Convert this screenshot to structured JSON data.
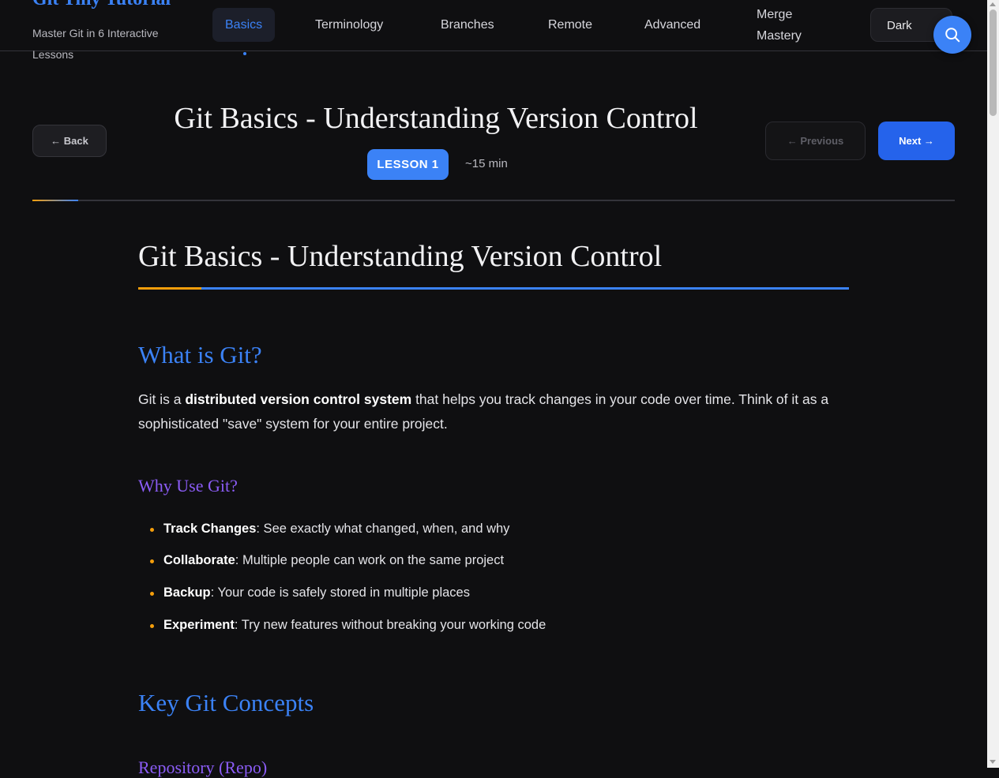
{
  "brand": {
    "title": "Git Tiny Tutorial",
    "subtitle": "Master Git in 6 Interactive Lessons"
  },
  "nav": {
    "items": [
      {
        "label": "Basics",
        "active": true
      },
      {
        "label": "Terminology"
      },
      {
        "label": "Branches"
      },
      {
        "label": "Remote"
      },
      {
        "label": "Advanced"
      },
      {
        "label_line1": "Merge",
        "label_line2": "Mastery"
      }
    ]
  },
  "theme": {
    "label": "Dark"
  },
  "search": {
    "icon": "search-icon"
  },
  "lesson": {
    "back_label": "← Back",
    "title": "Git Basics - Understanding Version Control",
    "badge": "LESSON 1",
    "time": "~15 min",
    "prev_label": "← Previous",
    "next_label": "Next →",
    "progress_percent": 5
  },
  "article": {
    "title": "Git Basics - Understanding Version Control",
    "section1": {
      "heading": "What is Git?",
      "para_before": "Git is a ",
      "para_bold": "distributed version control system",
      "para_after": " that helps you track changes in your code over time. Think of it as a sophisticated \"save\" system for your entire project."
    },
    "why": {
      "heading": "Why Use Git?",
      "items": [
        {
          "term": "Track Changes",
          "text": ": See exactly what changed, when, and why"
        },
        {
          "term": "Collaborate",
          "text": ": Multiple people can work on the same project"
        },
        {
          "term": "Backup",
          "text": ": Your code is safely stored in multiple places"
        },
        {
          "term": "Experiment",
          "text": ": Try new features without breaking your working code"
        }
      ]
    },
    "section2": {
      "heading": "Key Git Concepts",
      "sub_heading": "Repository (Repo)"
    }
  },
  "colors": {
    "accent": "#3b82f6",
    "secondary": "#8b5cf6",
    "highlight": "#f59e0b",
    "background": "#0f0f11"
  }
}
